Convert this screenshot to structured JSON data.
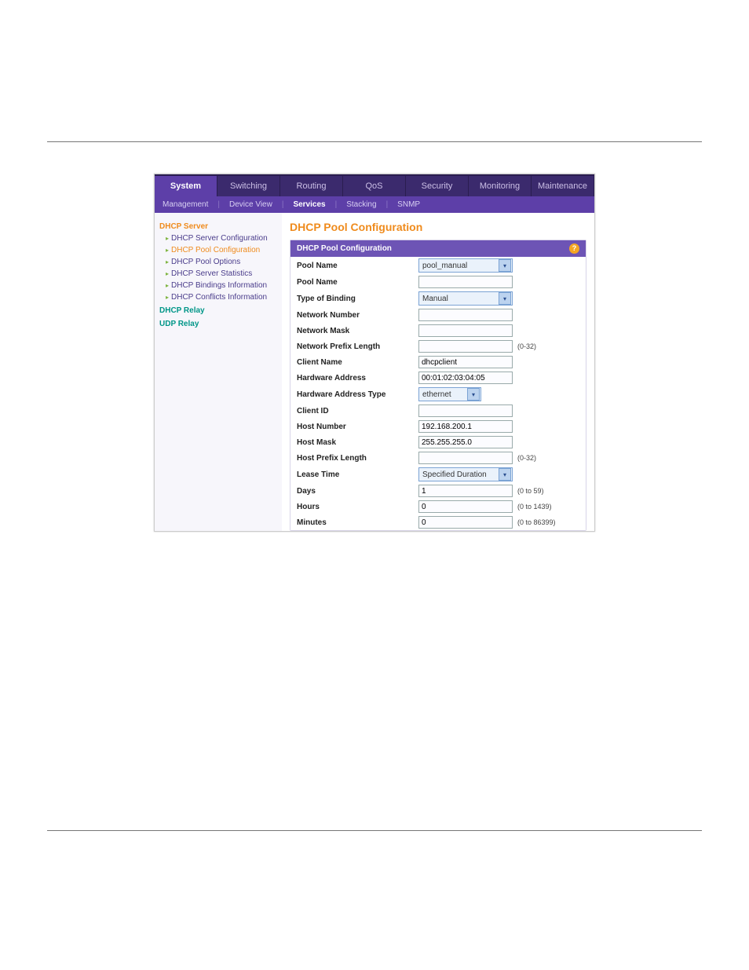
{
  "tabs": [
    "System",
    "Switching",
    "Routing",
    "QoS",
    "Security",
    "Monitoring",
    "Maintenance"
  ],
  "active_tab": "System",
  "subtabs": [
    "Management",
    "Device View",
    "Services",
    "Stacking",
    "SNMP"
  ],
  "active_subtab": "Services",
  "sidebar": {
    "sections": [
      {
        "label": "DHCP Server",
        "style": "orange",
        "items": [
          {
            "label": "DHCP Server Configuration"
          },
          {
            "label": "DHCP Pool Configuration",
            "active": true
          },
          {
            "label": "DHCP Pool Options"
          },
          {
            "label": "DHCP Server Statistics"
          },
          {
            "label": "DHCP Bindings Information"
          },
          {
            "label": "DHCP Conflicts Information"
          }
        ]
      },
      {
        "label": "DHCP Relay",
        "style": "teal",
        "items": []
      },
      {
        "label": "UDP Relay",
        "style": "teal",
        "items": []
      }
    ]
  },
  "page_title": "DHCP Pool Configuration",
  "panel_title": "DHCP Pool Configuration",
  "fields": {
    "pool_select": {
      "label": "Pool Name",
      "value": "pool_manual",
      "type": "select"
    },
    "pool_name": {
      "label": "Pool Name",
      "value": "",
      "type": "text"
    },
    "binding": {
      "label": "Type of Binding",
      "value": "Manual",
      "type": "select"
    },
    "net_num": {
      "label": "Network Number",
      "value": "",
      "type": "text"
    },
    "net_mask": {
      "label": "Network Mask",
      "value": "",
      "type": "text"
    },
    "net_prefix": {
      "label": "Network Prefix Length",
      "value": "",
      "type": "text",
      "hint": "(0-32)"
    },
    "client_name": {
      "label": "Client Name",
      "value": "dhcpclient",
      "type": "text"
    },
    "hw_addr": {
      "label": "Hardware Address",
      "value": "00:01:02:03:04:05",
      "type": "text"
    },
    "hw_type": {
      "label": "Hardware Address Type",
      "value": "ethernet",
      "type": "select"
    },
    "client_id": {
      "label": "Client ID",
      "value": "",
      "type": "text"
    },
    "host_num": {
      "label": "Host Number",
      "value": "192.168.200.1",
      "type": "text"
    },
    "host_mask": {
      "label": "Host Mask",
      "value": "255.255.255.0",
      "type": "text"
    },
    "host_prefix": {
      "label": "Host Prefix Length",
      "value": "",
      "type": "text",
      "hint": "(0-32)"
    },
    "lease": {
      "label": "Lease Time",
      "value": "Specified Duration",
      "type": "select"
    },
    "days": {
      "label": "Days",
      "value": "1",
      "type": "text",
      "hint": "(0 to 59)"
    },
    "hours": {
      "label": "Hours",
      "value": "0",
      "type": "text",
      "hint": "(0 to 1439)"
    },
    "minutes": {
      "label": "Minutes",
      "value": "0",
      "type": "text",
      "hint": "(0 to 86399)"
    }
  },
  "help_icon": "?"
}
